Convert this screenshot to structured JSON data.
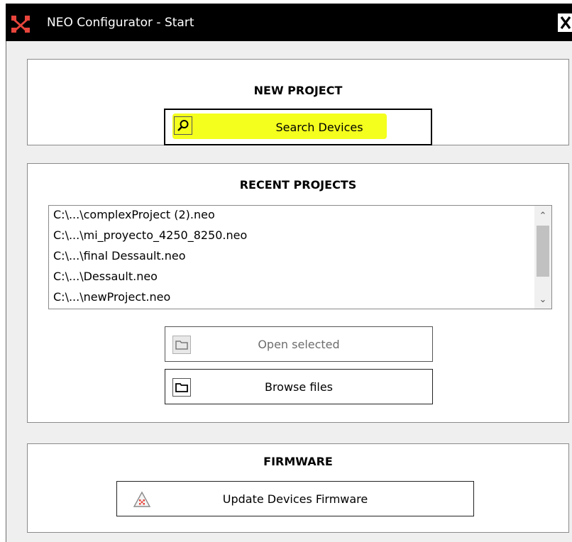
{
  "window": {
    "title": "NEO Configurator - Start",
    "close_glyph": "X"
  },
  "new_project": {
    "heading": "NEW PROJECT",
    "search_button": {
      "label": "Search Devices",
      "icon": "search-icon",
      "highlight_color": "#f4ff1e"
    }
  },
  "recent_projects": {
    "heading": "RECENT PROJECTS",
    "items": [
      "C:\\...\\complexProject (2).neo",
      "C:\\...\\mi_proyecto_4250_8250.neo",
      "C:\\...\\final Dessault.neo",
      "C:\\...\\Dessault.neo",
      "C:\\...\\newProject.neo"
    ],
    "open_selected_button": {
      "label": "Open selected",
      "icon": "folder-icon",
      "enabled": false
    },
    "browse_files_button": {
      "label": "Browse files",
      "icon": "folder-icon",
      "enabled": true
    }
  },
  "firmware": {
    "heading": "FIRMWARE",
    "update_button": {
      "label": "Update Devices Firmware",
      "icon": "warning-triangle-icon"
    }
  },
  "colors": {
    "titlebar": "#000000",
    "window_background": "#efefef",
    "panel_background": "#ffffff",
    "disabled_text": "#6d6d6d",
    "logo_red": "#e8453c"
  }
}
